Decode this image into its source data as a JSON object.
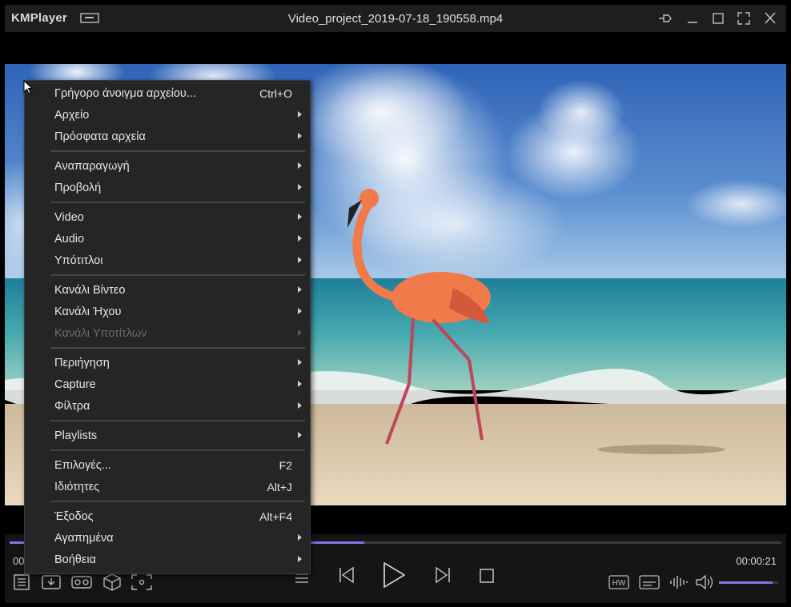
{
  "app": {
    "name": "KMPlayer",
    "file_title": "Video_project_2019-07-18_190558.mp4"
  },
  "player": {
    "current_time_partial": "00",
    "total_time": "00:00:21",
    "progress": 0.46,
    "volume": 0.9
  },
  "menu": {
    "items": [
      {
        "label": "Γρήγορο άνοιγμα αρχείου...",
        "shortcut": "Ctrl+O"
      },
      {
        "label": "Αρχείο",
        "shortcut": ""
      },
      {
        "label": "Πρόσφατα αρχεία",
        "shortcut": ""
      },
      {
        "label": "Αναπαραγωγή",
        "shortcut": ""
      },
      {
        "label": "Προβολή",
        "shortcut": ""
      },
      {
        "label": "Video",
        "shortcut": ""
      },
      {
        "label": "Audio",
        "shortcut": ""
      },
      {
        "label": "Υπότιτλοι",
        "shortcut": ""
      },
      {
        "label": "Κανάλι Βίντεο",
        "shortcut": ""
      },
      {
        "label": "Κανάλι Ήχου",
        "shortcut": ""
      },
      {
        "label": "Κανάλι Υποτίτλων",
        "shortcut": ""
      },
      {
        "label": "Περιήγηση",
        "shortcut": ""
      },
      {
        "label": "Capture",
        "shortcut": ""
      },
      {
        "label": "Φίλτρα",
        "shortcut": ""
      },
      {
        "label": "Playlists",
        "shortcut": ""
      },
      {
        "label": "Επιλογές...",
        "shortcut": "F2"
      },
      {
        "label": "Ιδιότητες",
        "shortcut": "Alt+J"
      },
      {
        "label": "Έξοδος",
        "shortcut": "Alt+F4"
      },
      {
        "label": "Αγαπημένα",
        "shortcut": ""
      },
      {
        "label": "Βοήθεια",
        "shortcut": ""
      }
    ]
  },
  "icons": {
    "titlebar": [
      "mini-mode-icon",
      "pin-icon",
      "minimize-icon",
      "maximize-icon",
      "fullscreen-icon",
      "close-icon"
    ],
    "controls": [
      "playlist-icon",
      "download-icon",
      "vr-icon",
      "3d-icon",
      "capture-icon",
      "previous-icon",
      "play-icon",
      "next-icon",
      "stop-icon",
      "hw-icon",
      "subtitle-icon",
      "equalizer-icon",
      "volume-icon"
    ]
  },
  "colors": {
    "accent": "#8b6fe8",
    "menu_bg": "#252525",
    "titlebar_bg": "#1e1e1e"
  }
}
